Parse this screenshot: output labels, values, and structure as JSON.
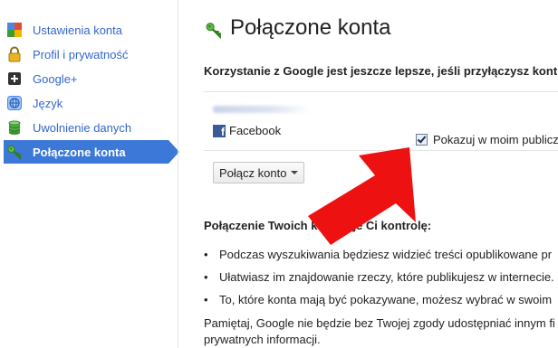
{
  "sidebar": {
    "items": [
      {
        "label": "Ustawienia konta",
        "icon": "settings-cube-icon"
      },
      {
        "label": "Profil i prywatność",
        "icon": "lock-icon"
      },
      {
        "label": "Google+",
        "icon": "google-plus-icon"
      },
      {
        "label": "Język",
        "icon": "globe-icon"
      },
      {
        "label": "Uwolnienie danych",
        "icon": "database-icon"
      },
      {
        "label": "Połączone konta",
        "icon": "key-icon",
        "active": true
      }
    ]
  },
  "main": {
    "title": "Połączone konta",
    "title_icon": "key-icon",
    "intro": "Korzystanie z Google jest jeszcze lepsze, jeśli przyłączysz kont",
    "account": {
      "service": "Facebook",
      "service_icon": "facebook-icon",
      "show_label": "Pokazuj w moim publicz",
      "show_checked": true
    },
    "connect_button": "Połącz konto",
    "section_heading": "Połączenie Twoich kont daje Ci kontrolę:",
    "bullets": [
      "Podczas wyszukiwania będziesz widzieć treści opublikowane pr",
      "Ułatwiasz im znajdowanie rzeczy, które publikujesz w internecie.",
      "To, które konta mają być pokazywane, możesz wybrać w swoim"
    ],
    "footer": "Pamiętaj, Google nie będzie bez Twojej zgody udostępniać innym fi prywatnych informacji."
  },
  "colors": {
    "link": "#3366cc",
    "active_bg": "#3c78d8",
    "annotation_arrow": "#ee1111",
    "facebook": "#3b5998"
  }
}
